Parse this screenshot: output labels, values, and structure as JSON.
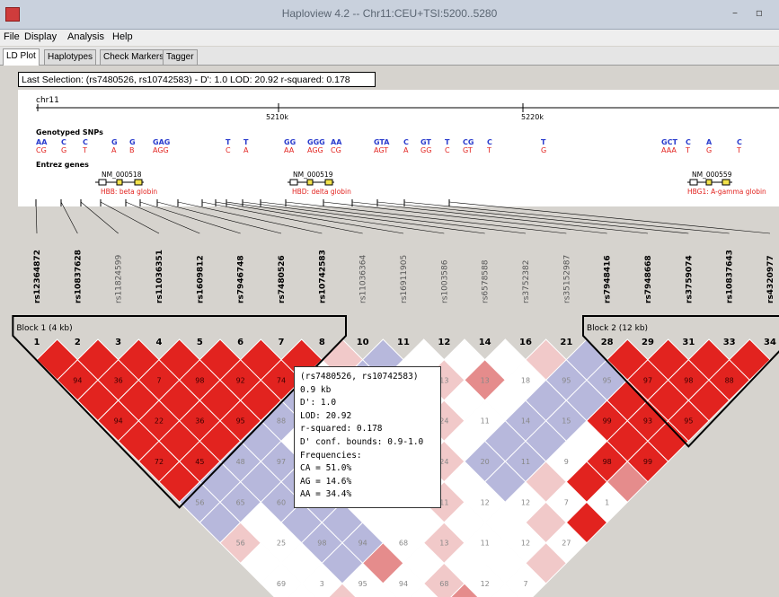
{
  "window": {
    "title": "Haploview 4.2 -- Chr11:CEU+TSI:5200..5280",
    "minimize": "–",
    "maximize": "▫"
  },
  "menu": [
    "File",
    "Display",
    "Analysis",
    "Help"
  ],
  "tabs": [
    "LD Plot",
    "Haplotypes",
    "Check Markers",
    "Tagger"
  ],
  "active_tab": "LD Plot",
  "status": "Last Selection: (rs7480526, rs10742583)  -  D': 1.0   LOD: 20.92   r-squared: 0.178",
  "genome": {
    "chrom": "chr11",
    "ticks": [
      "5210k",
      "5220k"
    ],
    "genotyped_label": "Genotyped SNPs",
    "entrez_label": "Entrez genes",
    "genes": [
      {
        "acc": "NM_000518",
        "name": "HBB: beta globin"
      },
      {
        "acc": "NM_000519",
        "name": "HBD: delta globin"
      },
      {
        "acc": "NM_000559",
        "name": "HBG1: A-gamma globin"
      }
    ],
    "snp_allele_groups": [
      {
        "top": "AA",
        "bot": "CG"
      },
      {
        "top": "C",
        "bot": "G"
      },
      {
        "top": "C",
        "bot": "T"
      },
      {
        "top": "G",
        "bot": "A"
      },
      {
        "top": "G",
        "bot": "B"
      },
      {
        "top": "GAG",
        "bot": "AGG"
      },
      {
        "top": "T",
        "bot": "C"
      },
      {
        "top": "T",
        "bot": "A"
      },
      {
        "top": "GG",
        "bot": "AA"
      },
      {
        "top": "GGG",
        "bot": "AGG"
      },
      {
        "top": "AA",
        "bot": "CG"
      },
      {
        "top": "GTA",
        "bot": "AGT"
      },
      {
        "top": "C",
        "bot": "A"
      },
      {
        "top": "GT",
        "bot": "GG"
      },
      {
        "top": "T",
        "bot": "C"
      },
      {
        "top": "CG",
        "bot": "GT"
      },
      {
        "top": "C",
        "bot": "T"
      },
      {
        "top": "T",
        "bot": "G"
      },
      {
        "top": "GCT",
        "bot": "AAA"
      },
      {
        "top": "C",
        "bot": "T"
      },
      {
        "top": "A",
        "bot": "G"
      },
      {
        "top": "C",
        "bot": "T"
      }
    ]
  },
  "markers": [
    {
      "name": "rs12364872",
      "num": "1",
      "bold": true
    },
    {
      "name": "rs10837628",
      "num": "2",
      "bold": true
    },
    {
      "name": "rs11824599",
      "num": "3",
      "bold": false
    },
    {
      "name": "rs11036351",
      "num": "4",
      "bold": true
    },
    {
      "name": "rs1609812",
      "num": "5",
      "bold": true
    },
    {
      "name": "rs7946748",
      "num": "6",
      "bold": true
    },
    {
      "name": "rs7480526",
      "num": "7",
      "bold": true
    },
    {
      "name": "rs10742583",
      "num": "8",
      "bold": true
    },
    {
      "name": "rs11036364",
      "num": "10",
      "bold": false
    },
    {
      "name": "rs16911905",
      "num": "11",
      "bold": false
    },
    {
      "name": "rs1003586",
      "num": "12",
      "bold": false
    },
    {
      "name": "rs6578588",
      "num": "14",
      "bold": false
    },
    {
      "name": "rs3752382",
      "num": "16",
      "bold": false
    },
    {
      "name": "rs35152987",
      "num": "21",
      "bold": false
    },
    {
      "name": "rs7948416",
      "num": "28",
      "bold": true
    },
    {
      "name": "rs7948668",
      "num": "29",
      "bold": true
    },
    {
      "name": "rs3759074",
      "num": "31",
      "bold": true
    },
    {
      "name": "rs10837643",
      "num": "33",
      "bold": true
    },
    {
      "name": "rs4320977",
      "num": "34",
      "bold": true
    }
  ],
  "blocks": [
    {
      "label": "Block 1 (4 kb)"
    },
    {
      "label": "Block 2 (12 kb)"
    }
  ],
  "cell_values": [
    "94",
    "94",
    "72",
    "56",
    "56",
    "69",
    "36",
    "22",
    "45",
    "65",
    "25",
    "3",
    "7",
    "36",
    "48",
    "60",
    "98",
    "95",
    "98",
    "95",
    "97",
    "96",
    "94",
    "94",
    "92",
    "88",
    "68",
    "68",
    "68",
    "68",
    "74",
    "47",
    "18",
    "39",
    "13",
    "12",
    "11",
    "24",
    "27",
    "11",
    "11",
    "7",
    "21",
    "8",
    "24",
    "12",
    "12",
    "22",
    "24",
    "20",
    "12",
    "27",
    "13",
    "11",
    "11",
    "7",
    "13",
    "14",
    "9",
    "1",
    "18",
    "15",
    "98",
    "95",
    "99",
    "99",
    "95",
    "93",
    "97",
    "95",
    "98",
    "88",
    "95",
    "95",
    "97",
    "97",
    "81"
  ],
  "tooltip": {
    "lines": [
      "(rs7480526, rs10742583)",
      "0.9 kb",
      "D': 1.0",
      "LOD: 20.92",
      "r-squared: 0.178",
      "D' conf. bounds: 0.9-1.0",
      "Frequencies:",
      "CA = 51.0%",
      "AG = 14.6%",
      "AA = 34.4%"
    ]
  },
  "colors": {
    "strong": "#e2231f",
    "weak": "#ffffff",
    "blue": "#b7b8dc",
    "pink1": "#f1c9c9",
    "pink2": "#e58c8c",
    "allele_top": "#2a3ccd",
    "allele_bot": "#e2231f"
  }
}
